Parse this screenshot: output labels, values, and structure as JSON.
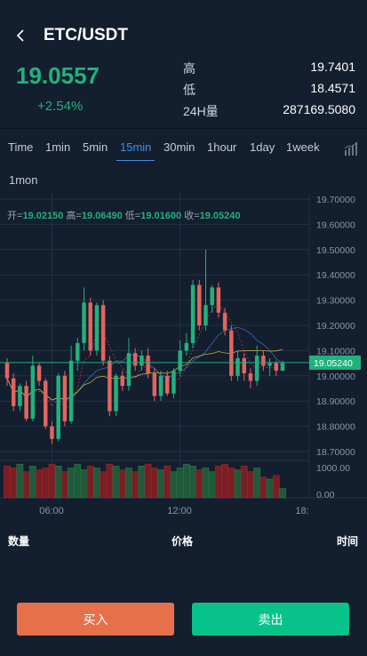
{
  "header": {
    "title": "ETC/USDT",
    "back_icon": "chevron-left-icon"
  },
  "ticker": {
    "price": "19.0557",
    "change": "+2.54%",
    "high_label": "高",
    "high_value": "19.7401",
    "low_label": "低",
    "low_value": "18.4571",
    "vol_label": "24H量",
    "vol_value": "287169.5080"
  },
  "periods": [
    {
      "label": "Time"
    },
    {
      "label": "1min"
    },
    {
      "label": "5min"
    },
    {
      "label": "15min",
      "active": true
    },
    {
      "label": "30min"
    },
    {
      "label": "1hour"
    },
    {
      "label": "1day"
    },
    {
      "label": "1week"
    },
    {
      "label": "1mon"
    }
  ],
  "ohlc": {
    "open_label": "开=",
    "open": "19.02150",
    "high_label": "高=",
    "high": "19.06490",
    "low_label": "低=",
    "low": "19.01600",
    "close_label": "收=",
    "close": "19.05240"
  },
  "chart_data": {
    "type": "candlestick",
    "y_ticks": [
      "19.70000",
      "19.60000",
      "19.50000",
      "19.40000",
      "19.30000",
      "19.20000",
      "19.10000",
      "19.00000",
      "18.90000",
      "18.80000",
      "18.70000"
    ],
    "ylim": [
      18.7,
      19.7
    ],
    "current_price_label": "19.05240",
    "current_price": 19.0524,
    "volume_ticks": [
      "1000.00",
      "0.00"
    ],
    "x_ticks": [
      "06:00",
      "12:00",
      "18:"
    ],
    "candles": [
      [
        19.05,
        18.99,
        19.07,
        18.96
      ],
      [
        18.99,
        18.88,
        19.01,
        18.86
      ],
      [
        18.88,
        18.96,
        18.97,
        18.86
      ],
      [
        18.96,
        18.83,
        18.98,
        18.82
      ],
      [
        18.83,
        19.04,
        19.08,
        18.82
      ],
      [
        19.04,
        18.98,
        19.05,
        18.96
      ],
      [
        18.98,
        18.8,
        18.99,
        18.79
      ],
      [
        18.8,
        18.75,
        18.82,
        18.73
      ],
      [
        18.75,
        19.0,
        19.01,
        18.74
      ],
      [
        19.0,
        18.82,
        19.02,
        18.8
      ],
      [
        18.82,
        19.06,
        19.12,
        18.81
      ],
      [
        19.06,
        19.13,
        19.15,
        19.02
      ],
      [
        19.13,
        19.29,
        19.35,
        19.1
      ],
      [
        19.29,
        19.1,
        19.31,
        19.08
      ],
      [
        19.1,
        19.28,
        19.29,
        19.08
      ],
      [
        19.28,
        19.06,
        19.3,
        19.04
      ],
      [
        19.06,
        18.86,
        19.08,
        18.84
      ],
      [
        18.86,
        19.0,
        19.01,
        18.84
      ],
      [
        19.0,
        18.96,
        19.02,
        18.94
      ],
      [
        18.96,
        19.09,
        19.15,
        18.94
      ],
      [
        19.09,
        19.04,
        19.11,
        19.02
      ],
      [
        19.04,
        19.08,
        19.1,
        19.02
      ],
      [
        19.08,
        19.01,
        19.11,
        18.99
      ],
      [
        19.01,
        18.92,
        19.03,
        18.9
      ],
      [
        18.92,
        19.0,
        19.02,
        18.9
      ],
      [
        19.0,
        18.93,
        19.02,
        18.92
      ],
      [
        18.93,
        19.02,
        19.03,
        18.91
      ],
      [
        19.02,
        19.1,
        19.14,
        19.0
      ],
      [
        19.1,
        19.13,
        19.17,
        19.08
      ],
      [
        19.13,
        19.36,
        19.38,
        19.11
      ],
      [
        19.36,
        19.2,
        19.38,
        19.18
      ],
      [
        19.2,
        19.28,
        19.5,
        19.18
      ],
      [
        19.28,
        19.35,
        19.36,
        19.25
      ],
      [
        19.35,
        19.25,
        19.37,
        19.23
      ],
      [
        19.25,
        19.18,
        19.27,
        19.16
      ],
      [
        19.18,
        19.0,
        19.2,
        18.98
      ],
      [
        19.0,
        19.07,
        19.1,
        18.98
      ],
      [
        19.07,
        19.01,
        19.09,
        18.98
      ],
      [
        19.01,
        18.98,
        19.03,
        18.95
      ],
      [
        18.98,
        19.08,
        19.12,
        18.96
      ],
      [
        19.08,
        19.04,
        19.1,
        19.02
      ],
      [
        19.04,
        19.05,
        19.07,
        19.0
      ],
      [
        19.05,
        19.02,
        19.06,
        19.0
      ],
      [
        19.02,
        19.05,
        19.06,
        19.02
      ]
    ],
    "volumes": [
      0.85,
      0.8,
      0.9,
      0.7,
      0.85,
      0.75,
      0.8,
      0.9,
      0.85,
      0.7,
      0.8,
      0.9,
      0.75,
      0.85,
      0.8,
      0.7,
      0.9,
      0.85,
      0.75,
      0.8,
      0.7,
      0.85,
      0.9,
      0.8,
      0.75,
      0.85,
      0.7,
      0.8,
      0.9,
      0.85,
      0.75,
      0.8,
      0.7,
      0.85,
      0.9,
      0.8,
      0.75,
      0.85,
      0.7,
      0.8,
      0.55,
      0.5,
      0.6,
      0.25
    ],
    "ma_colors": [
      "#d63a5c",
      "#3a79c9",
      "#e8c14a"
    ]
  },
  "colors": {
    "up": "#20b27d",
    "down": "#e2655e",
    "grid": "#243246",
    "buy": "#e6704a",
    "sell": "#07c38a"
  },
  "trades": {
    "qty_label": "数量",
    "price_label": "价格",
    "time_label": "时间"
  },
  "actions": {
    "buy": "买入",
    "sell": "卖出"
  }
}
